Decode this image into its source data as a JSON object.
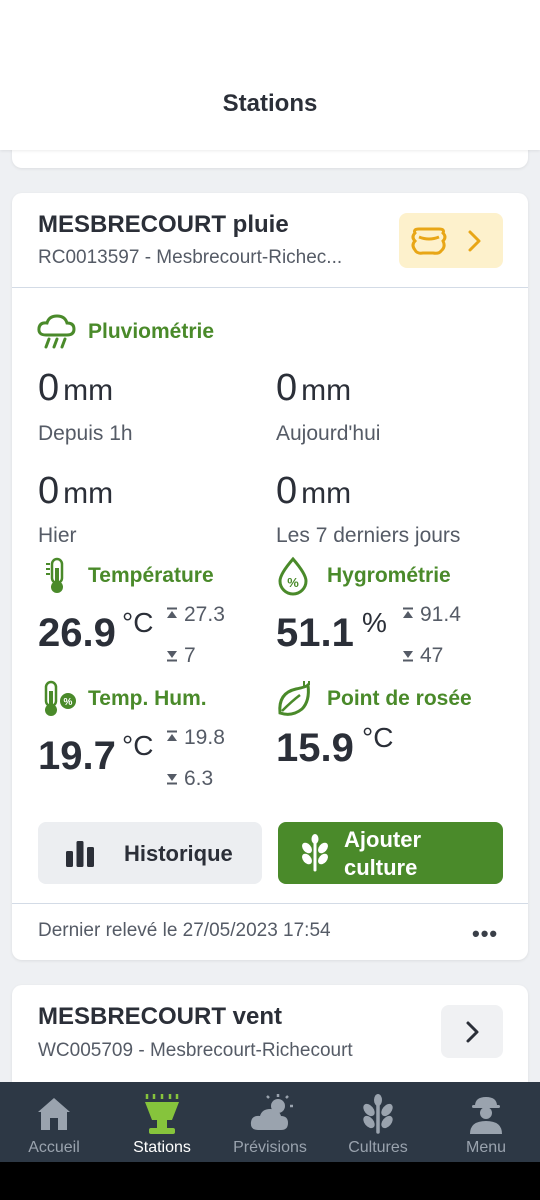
{
  "header": {
    "title": "Stations"
  },
  "station": {
    "name": "MESBRECOURT pluie",
    "subtitle": "RC0013597 - Mesbrecourt-Richec...",
    "pluvio": {
      "title": "Pluviométrie",
      "unit": "mm",
      "items": [
        {
          "value": "0",
          "label": "Depuis 1h"
        },
        {
          "value": "0",
          "label": "Aujourd'hui"
        },
        {
          "value": "0",
          "label": "Hier"
        },
        {
          "value": "0",
          "label": "Les 7 derniers jours"
        }
      ]
    },
    "temperature": {
      "title": "Température",
      "value": "26.9",
      "unit": "°C",
      "max": "27.3",
      "min": "7"
    },
    "hygrometry": {
      "title": "Hygrométrie",
      "value": "51.1",
      "unit": "%",
      "max": "91.4",
      "min": "47"
    },
    "temp_hum": {
      "title": "Temp. Hum.",
      "value": "19.7",
      "unit": "°C",
      "max": "19.8",
      "min": "6.3"
    },
    "dew_point": {
      "title": "Point de rosée",
      "value": "15.9",
      "unit": "°C"
    },
    "buttons": {
      "history": "Historique",
      "add_crop_line1": "Ajouter",
      "add_crop_line2": "culture"
    },
    "last_reading": "Dernier relevé le 27/05/2023 17:54",
    "more": "•••"
  },
  "next_station": {
    "name": "MESBRECOURT vent",
    "subtitle": "WC005709 - Mesbrecourt-Richecourt"
  },
  "nav": {
    "items": [
      {
        "label": "Accueil",
        "icon": "home-icon"
      },
      {
        "label": "Stations",
        "icon": "station-icon"
      },
      {
        "label": "Prévisions",
        "icon": "weather-icon"
      },
      {
        "label": "Cultures",
        "icon": "crop-icon"
      },
      {
        "label": "Menu",
        "icon": "user-icon"
      }
    ],
    "active": "Stations"
  },
  "colors": {
    "accent": "#4a8a2a",
    "nav_bg": "#2d3845",
    "sensor_bg": "#fdf1cc",
    "sensor_icon": "#e8a616"
  }
}
